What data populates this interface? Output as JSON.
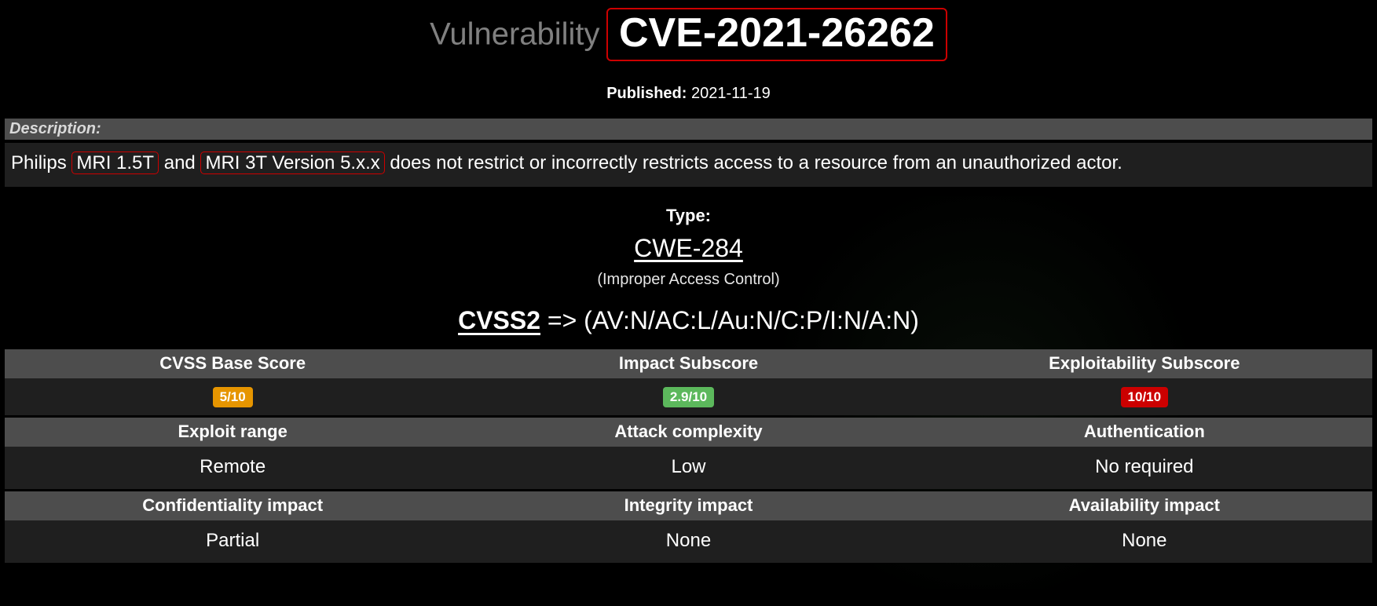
{
  "title": {
    "prefix": "Vulnerability",
    "cve": "CVE-2021-26262"
  },
  "published": {
    "label": "Published:",
    "date": "2021-11-19"
  },
  "description": {
    "header": "Description:",
    "parts": {
      "p1": "Philips ",
      "hl1": "MRI 1.5T",
      "p2": " and ",
      "hl2": "MRI 3T Version 5.x.x",
      "p3": " does not restrict or incorrectly restricts access to a resource from an unauthorized actor."
    }
  },
  "type": {
    "label": "Type:",
    "cwe": "CWE-284",
    "cwe_desc": "(Improper Access Control)"
  },
  "cvss": {
    "label": "CVSS2",
    "arrow": " => ",
    "vector": "(AV:N/AC:L/Au:N/C:P/I:N/A:N)"
  },
  "scores": {
    "h1": "CVSS Base Score",
    "h2": "Impact Subscore",
    "h3": "Exploitability Subscore",
    "v1": "5/10",
    "v2": "2.9/10",
    "v3": "10/10"
  },
  "attrs": {
    "h1": "Exploit range",
    "h2": "Attack complexity",
    "h3": "Authentication",
    "v1": "Remote",
    "v2": "Low",
    "v3": "No required"
  },
  "impacts": {
    "h1": "Confidentiality impact",
    "h2": "Integrity impact",
    "h3": "Availability impact",
    "v1": "Partial",
    "v2": "None",
    "v3": "None"
  }
}
